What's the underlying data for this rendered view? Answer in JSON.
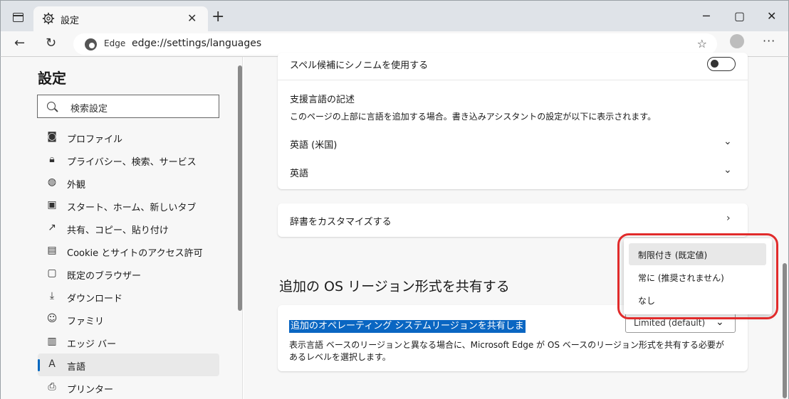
{
  "window": {
    "tab_title": "設定",
    "controls": [
      "─",
      "▢",
      "✕"
    ]
  },
  "address_bar": {
    "site_label": "Edge",
    "url": "edge://settings/languages"
  },
  "sidebar": {
    "title": "設定",
    "search_placeholder": "検索設定",
    "items": [
      {
        "label": "プロファイル",
        "icon": "profile-icon"
      },
      {
        "label": "プライバシー、検索、サービス",
        "icon": "lock-icon"
      },
      {
        "label": "外観",
        "icon": "palette-icon"
      },
      {
        "label": "スタート、ホーム、新しいタブ",
        "icon": "home-tab-icon"
      },
      {
        "label": "共有、コピー、貼り付け",
        "icon": "share-icon"
      },
      {
        "label": "Cookie とサイトのアクセス許可",
        "icon": "cookie-icon"
      },
      {
        "label": "既定のブラウザー",
        "icon": "browser-icon"
      },
      {
        "label": "ダウンロード",
        "icon": "download-icon"
      },
      {
        "label": "ファミリ",
        "icon": "family-icon"
      },
      {
        "label": "エッジ バー",
        "icon": "edge-bar-icon"
      },
      {
        "label": "言語",
        "icon": "language-icon",
        "active": true
      },
      {
        "label": "プリンター",
        "icon": "printer-icon"
      }
    ]
  },
  "main": {
    "spell_synonym_label": "スペル候補にシノニムを使用する",
    "writing_heading": "支援言語の記述",
    "writing_desc": "このページの上部に言語を追加する場合。書き込みアシスタントの設定が以下に表示されます。",
    "languages": [
      "英語 (米国)",
      "英語"
    ],
    "customize_dictionary": "辞書をカスタマイズする",
    "os_region_heading": "追加の OS リージョン形式を共有する",
    "os_region_label": "追加のオペレーティング システムリージョンを共有しま",
    "os_region_desc_1": "表示言語 ベースのリージョンと異なる場合に、Microsoft Edge が OS ベースのリージョン形式を共有する必要が",
    "os_region_desc_2": "あるレベルを選択します。",
    "select_value": "Limited (default)"
  },
  "dropdown": {
    "options": [
      "制限付き (既定値)",
      "常に (推奨されません)",
      "なし"
    ],
    "selected_index": 0
  },
  "colors": {
    "accent": "#0067c0",
    "highlight_box": "#e12b2b"
  }
}
